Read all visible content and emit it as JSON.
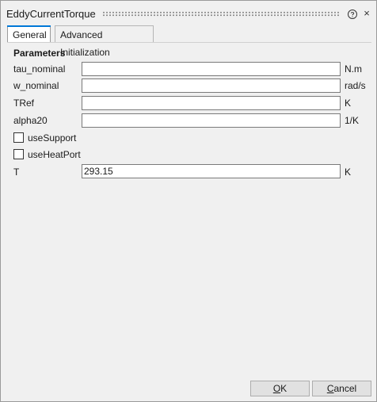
{
  "window": {
    "title": "EddyCurrentTorque",
    "help_glyph": "?",
    "close_glyph": "×"
  },
  "tabs": [
    {
      "label": "General"
    },
    {
      "label": "Advanced Initialization"
    }
  ],
  "parameters": {
    "title": "Parameters",
    "fields": [
      {
        "label": "tau_nominal",
        "value": "",
        "unit": "N.m"
      },
      {
        "label": "w_nominal",
        "value": "",
        "unit": "rad/s"
      },
      {
        "label": "TRef",
        "value": "",
        "unit": "K"
      },
      {
        "label": "alpha20",
        "value": "",
        "unit": "1/K"
      }
    ],
    "checkboxes": [
      {
        "label": "useSupport",
        "checked": false
      },
      {
        "label": "useHeatPort",
        "checked": false
      }
    ],
    "t_field": {
      "label": "T",
      "value": "293.15",
      "unit": "K"
    }
  },
  "buttons": {
    "ok_first": "O",
    "ok_rest": "K",
    "cancel_first": "C",
    "cancel_rest": "ancel"
  }
}
